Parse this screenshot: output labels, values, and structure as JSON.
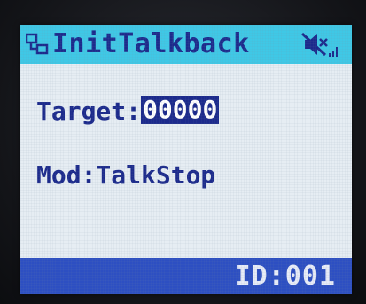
{
  "title_bar": {
    "title": "InitTalkback",
    "icons": [
      "talkback-icon",
      "mute-icon",
      "signal-icon"
    ]
  },
  "main": {
    "target_label": "Target:",
    "target_value": "00000",
    "mode_text": "Mod:TalkStop"
  },
  "status_bar": {
    "id_text": "ID:001"
  },
  "colors": {
    "title_bar": "#3fc8e6",
    "screen_background": "#e6edf3",
    "text": "#1c2a8c",
    "status_bar": "#2d4fc2",
    "highlight": "#1c2a8c"
  }
}
